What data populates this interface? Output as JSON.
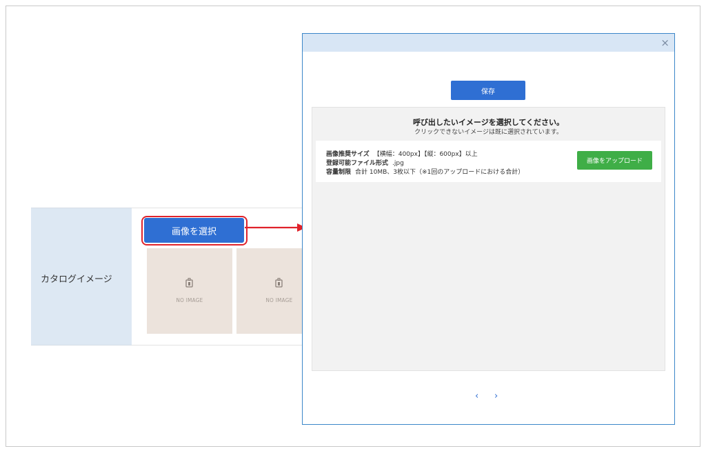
{
  "form": {
    "label": "カタログイメージ",
    "select_button": "画像を選択",
    "thumbnails": [
      {
        "placeholder": "NO IMAGE"
      },
      {
        "placeholder": "NO IMAGE"
      }
    ]
  },
  "modal": {
    "close": "×",
    "save_button": "保存",
    "title": "呼び出したいイメージを選択してください。",
    "subtitle": "クリックできないイメージは既に選択されています。",
    "info": {
      "size_label": "画像推奨サイズ",
      "size_value": "【横幅：400px】【縦：600px】以上",
      "format_label": "登録可能ファイル形式",
      "format_value": ".jpg",
      "limit_label": "容量制限",
      "limit_value": "合計 10MB、3枚以下（※1回のアップロードにおける合計）"
    },
    "upload_button": "画像をアップロード",
    "pager": {
      "prev": "‹",
      "next": "›"
    }
  },
  "colors": {
    "primary": "#2f6fd3",
    "upload": "#3fae47",
    "highlight": "#e0222a",
    "label_bg": "#dde8f3",
    "modal_header": "#d8e6f5"
  }
}
